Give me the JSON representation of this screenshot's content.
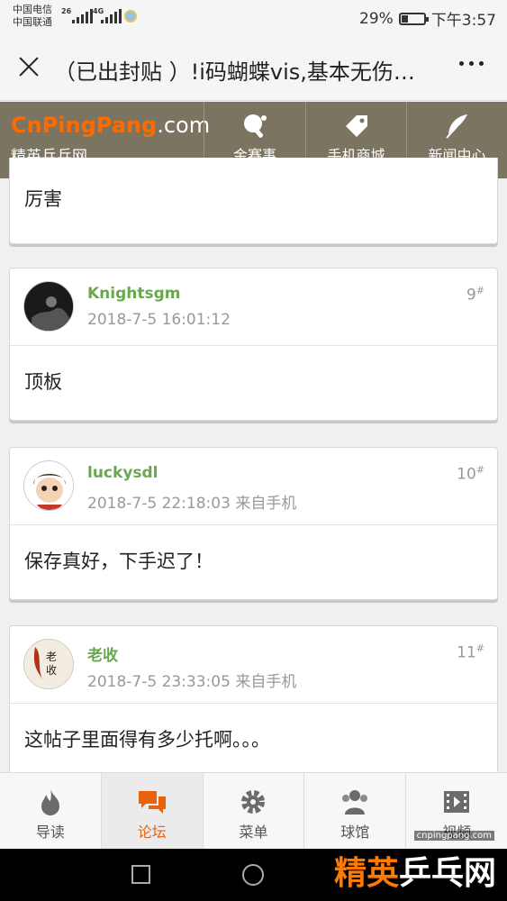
{
  "status_bar": {
    "carrier1": "中国电信",
    "carrier2": "中国联通",
    "sig1_label": "26",
    "sig2_label": "4G",
    "battery_pct": "29%",
    "battery_level": 0.29,
    "time": "下午3:57"
  },
  "titlebar": {
    "title": "（已出封贴 ）!i码蝴蝶vis,基本无伤…"
  },
  "site": {
    "logo_brand": "CnPingPang",
    "logo_domain": ".com",
    "logo_sub": "精英乒乓网",
    "nav": [
      {
        "label": "金赛事",
        "icon": "pingpong-paddle-icon"
      },
      {
        "label": "手机商城",
        "icon": "price-tag-icon"
      },
      {
        "label": "新闻中心",
        "icon": "feather-icon"
      }
    ]
  },
  "posts": [
    {
      "body": "厉害"
    },
    {
      "username": "Knightsgm",
      "meta": "2018-7-5 16:01:12",
      "floor": "9",
      "body": "顶板"
    },
    {
      "username": "luckysdl",
      "meta": "2018-7-5 22:18:03 来自手机",
      "floor": "10",
      "body": "保存真好，下手迟了！"
    },
    {
      "username": "老收",
      "meta": "2018-7-5 23:33:05 来自手机",
      "floor": "11",
      "body": "这帖子里面得有多少托啊。。。",
      "avatar_text": "老收"
    }
  ],
  "floor_mark": "#",
  "tabs": [
    {
      "label": "导读",
      "icon": "flame-icon"
    },
    {
      "label": "论坛",
      "icon": "chat-bubbles-icon",
      "active": true
    },
    {
      "label": "菜单",
      "icon": "gear-icon"
    },
    {
      "label": "球馆",
      "icon": "users-icon"
    },
    {
      "label": "视频",
      "icon": "film-icon"
    }
  ],
  "watermark": {
    "url": "cnpingpang.com",
    "text1": "精英",
    "text2": "乒乓网"
  },
  "colors": {
    "header_bg": "#7a7461",
    "brand_orange": "#ff6a00",
    "username_green": "#6aa84f",
    "active_tab": "#e8620a"
  }
}
